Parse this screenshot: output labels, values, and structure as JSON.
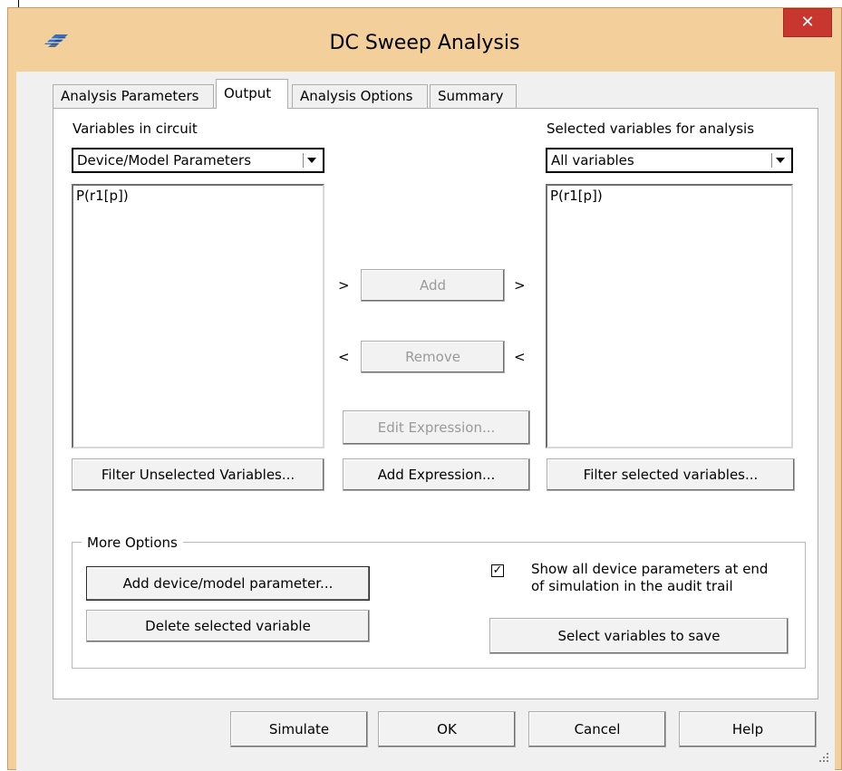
{
  "window": {
    "title": "DC Sweep Analysis",
    "close_label": "✕"
  },
  "tabs": [
    {
      "label": "Analysis Parameters",
      "active": false
    },
    {
      "label": "Output",
      "active": true
    },
    {
      "label": "Analysis Options",
      "active": false
    },
    {
      "label": "Summary",
      "active": false
    }
  ],
  "left": {
    "label": "Variables in circuit",
    "dropdown_value": "Device/Model Parameters",
    "items": [
      "P(r1[p])"
    ],
    "filter_button": "Filter Unselected Variables..."
  },
  "right": {
    "label": "Selected variables for analysis",
    "dropdown_value": "All variables",
    "items": [
      "P(r1[p])"
    ],
    "filter_button": "Filter selected variables..."
  },
  "middle": {
    "add_label": "Add",
    "add_left_arrow": ">",
    "add_right_arrow": ">",
    "remove_label": "Remove",
    "remove_left_arrow": "<",
    "remove_right_arrow": "<",
    "edit_expression_label": "Edit Expression...",
    "add_expression_label": "Add Expression..."
  },
  "more_options": {
    "legend": "More Options",
    "add_param_button": "Add device/model parameter...",
    "delete_button": "Delete selected variable",
    "show_params_checked": true,
    "checkmark": "✓",
    "show_params_line1": "Show all device parameters at end",
    "show_params_line2": "of simulation in the audit trail",
    "select_vars_button": "Select variables to save"
  },
  "footer": {
    "simulate": "Simulate",
    "ok": "OK",
    "cancel": "Cancel",
    "help": "Help"
  },
  "colors": {
    "title_frame": "#f3cf9c",
    "close_button": "#c7372f",
    "dialog_bg": "#f0f0f0"
  }
}
